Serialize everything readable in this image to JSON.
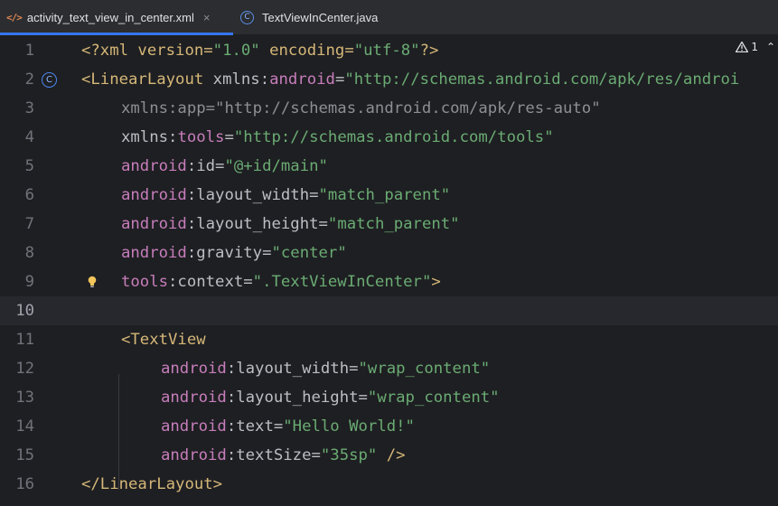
{
  "tabs": [
    {
      "label": "activity_text_view_in_center.xml",
      "icon": "xml-icon",
      "active": true,
      "close": "×"
    },
    {
      "label": "TextViewInCenter.java",
      "icon": "java-class-icon",
      "active": false
    }
  ],
  "inspection": {
    "count": "1"
  },
  "lines": [
    {
      "num": "1"
    },
    {
      "num": "2"
    },
    {
      "num": "3"
    },
    {
      "num": "4"
    },
    {
      "num": "5"
    },
    {
      "num": "6"
    },
    {
      "num": "7"
    },
    {
      "num": "8"
    },
    {
      "num": "9"
    },
    {
      "num": "10"
    },
    {
      "num": "11"
    },
    {
      "num": "12"
    },
    {
      "num": "13"
    },
    {
      "num": "14"
    },
    {
      "num": "15"
    },
    {
      "num": "16"
    }
  ],
  "code": {
    "l1": {
      "p1": "<?xml version=",
      "p2": "\"1.0\"",
      "p3": " encoding=",
      "p4": "\"utf-8\"",
      "p5": "?>"
    },
    "l2": {
      "tag": "<LinearLayout",
      "attr": " xmlns:",
      "ns": "android",
      "eq": "=",
      "val": "\"http://schemas.android.com/apk/res/androi"
    },
    "l3": {
      "text": "xmlns:app=\"http://schemas.android.com/apk/res-auto\""
    },
    "l4": {
      "attr": "xmlns:",
      "ns": "tools",
      "eq": "=",
      "val": "\"http://schemas.android.com/tools\""
    },
    "l5": {
      "ns": "android",
      "attr": ":id=",
      "val": "\"@+id/main\""
    },
    "l6": {
      "ns": "android",
      "attr": ":layout_width=",
      "val": "\"match_parent\""
    },
    "l7": {
      "ns": "android",
      "attr": ":layout_height=",
      "val": "\"match_parent\""
    },
    "l8": {
      "ns": "android",
      "attr": ":gravity=",
      "val": "\"center\""
    },
    "l9": {
      "ns": "tools",
      "attr": ":context=",
      "val": "\".TextViewInCenter\"",
      "end": ">"
    },
    "l11": {
      "tag": "<TextView"
    },
    "l12": {
      "ns": "android",
      "attr": ":layout_width=",
      "val": "\"wrap_content\""
    },
    "l13": {
      "ns": "android",
      "attr": ":layout_height=",
      "val": "\"wrap_content\""
    },
    "l14": {
      "ns": "android",
      "attr": ":text=",
      "val": "\"Hello World!\""
    },
    "l15": {
      "ns": "android",
      "attr": ":textSize=",
      "val": "\"35sp\"",
      "end": " />"
    },
    "l16": {
      "tag": "</LinearLayout",
      "end": ">"
    }
  }
}
